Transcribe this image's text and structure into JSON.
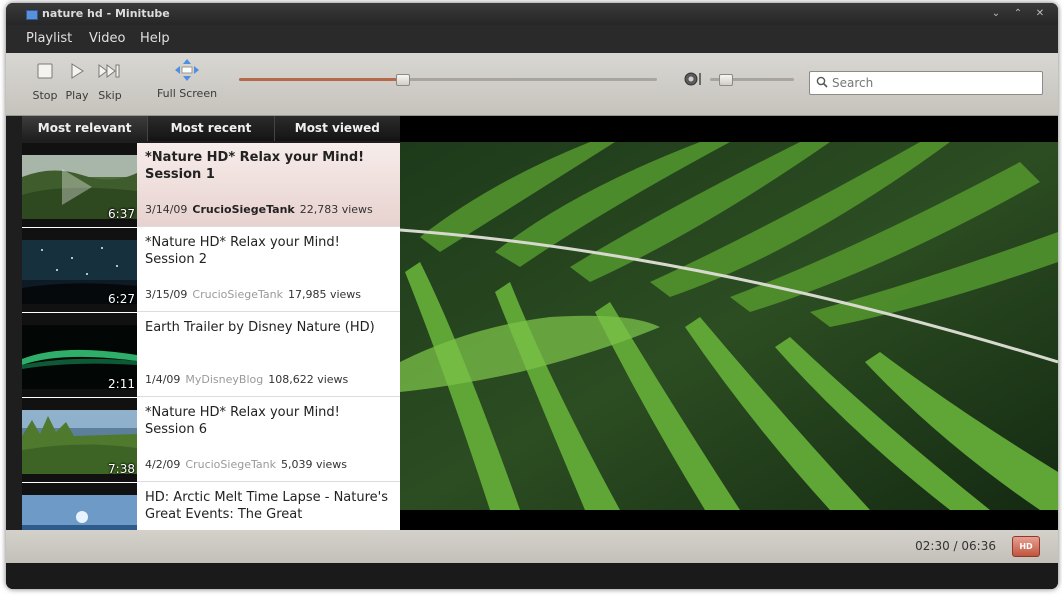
{
  "window": {
    "title": "nature hd - Minitube"
  },
  "menubar": {
    "items": [
      "Playlist",
      "Video",
      "Help"
    ]
  },
  "toolbar": {
    "stop_label": "Stop",
    "play_label": "Play",
    "skip_label": "Skip",
    "fullscreen_label": "Full Screen",
    "seek_progress": 0.39,
    "volume_level": 0.15
  },
  "search": {
    "placeholder": "Search",
    "value": ""
  },
  "tabs": [
    {
      "label": "Most relevant",
      "active": true
    },
    {
      "label": "Most recent",
      "active": false
    },
    {
      "label": "Most viewed",
      "active": false
    }
  ],
  "playlist": [
    {
      "title": "*Nature HD* Relax your Mind! Session 1",
      "date": "3/14/09",
      "author": "CrucioSiegeTank",
      "views": "22,783 views",
      "duration": "6:37",
      "selected": true,
      "thumb": "forest"
    },
    {
      "title": "*Nature HD* Relax your Mind! Session 2",
      "date": "3/15/09",
      "author": "CrucioSiegeTank",
      "views": "17,985 views",
      "duration": "6:27",
      "selected": false,
      "thumb": "stars"
    },
    {
      "title": "Earth Trailer by Disney Nature (HD)",
      "date": "1/4/09",
      "author": "MyDisneyBlog",
      "views": "108,622 views",
      "duration": "2:11",
      "selected": false,
      "thumb": "aurora"
    },
    {
      "title": "*Nature HD* Relax your Mind! Session 6",
      "date": "4/2/09",
      "author": "CrucioSiegeTank",
      "views": "5,039 views",
      "duration": "7:38",
      "selected": false,
      "thumb": "meadow"
    },
    {
      "title": "HD: Arctic Melt Time Lapse - Nature's Great Events: The Great",
      "date": "",
      "author": "",
      "views": "",
      "duration": "",
      "selected": false,
      "thumb": "arctic"
    }
  ],
  "status": {
    "time": "02:30 / 06:36",
    "hd_label": "HD"
  },
  "colors": {
    "accent": "#b5694a",
    "selected_row": "#ecdcd9",
    "chrome_dark": "#262626",
    "toolbar_bg": "#d0cdc7"
  }
}
